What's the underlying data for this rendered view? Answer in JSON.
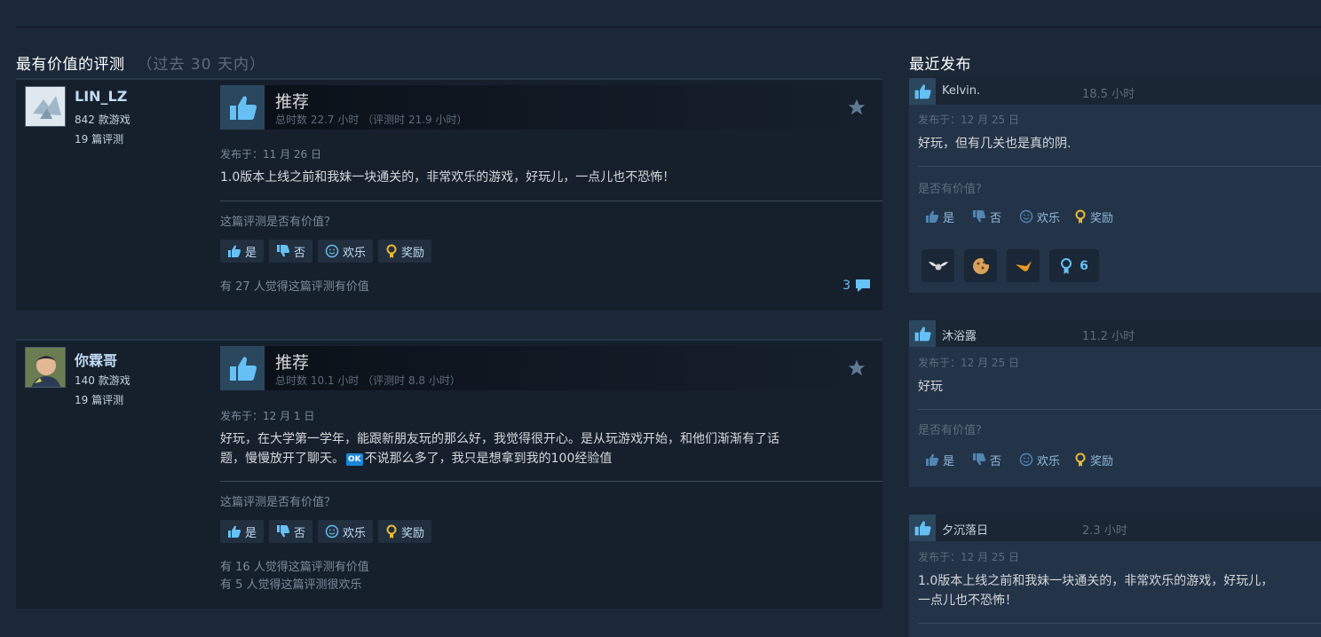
{
  "left_section": {
    "title": "最有价值的评测",
    "subtitle": "（过去 30 天内）"
  },
  "right_section": {
    "title": "最近发布"
  },
  "reviews": [
    {
      "author": "LIN_LZ",
      "games": "842 款游戏",
      "review_count": "19 篇评测",
      "verdict": "推荐",
      "hours": "总时数 22.7 小时 （评测时 21.9 小时）",
      "posted": "发布于：11 月 26 日",
      "text": "1.0版本上线之前和我妹一块通关的，非常欢乐的游戏，好玩儿，一点儿也不恐怖！",
      "helpful_question": "这篇评测是否有价值？",
      "buttons": {
        "yes": "是",
        "no": "否",
        "funny": "欢乐",
        "award": "奖励"
      },
      "helpful_line1": "有 27 人觉得这篇评测有价值",
      "helpful_line2": "",
      "comments": "3"
    },
    {
      "author": "你霖哥",
      "games": "140 款游戏",
      "review_count": "19 篇评测",
      "verdict": "推荐",
      "hours": "总时数 10.1 小时 （评测时 8.8 小时）",
      "posted": "发布于：12 月 1 日",
      "text_line1": "好玩，在大学第一学年，能跟新朋友玩的那么好，我觉得很开心。是从玩游戏开始，和他们渐渐有了话",
      "text_line2_a": "题，慢慢放开了聊天。",
      "text_ok": "OK",
      "text_line2_b": "不说那么多了，我只是想拿到我的100经验值",
      "helpful_question": "这篇评测是否有价值？",
      "buttons": {
        "yes": "是",
        "no": "否",
        "funny": "欢乐",
        "award": "奖励"
      },
      "helpful_line1": "有 16 人觉得这篇评测有价值",
      "helpful_line2": "有 5 人觉得这篇评测很欢乐"
    }
  ],
  "recent": [
    {
      "name": "Kelvin.",
      "hours": "18.5 小时",
      "posted": "发布于：12 月 25 日",
      "text": "好玩，但有几关也是真的阴.",
      "helpful_question": "是否有价值?",
      "buttons": {
        "yes": "是",
        "no": "否",
        "funny": "欢乐",
        "award": "奖励"
      },
      "award_count": "6"
    },
    {
      "name": "沐浴露",
      "hours": "11.2 小时",
      "posted": "发布于：12 月 25 日",
      "text": "好玩",
      "helpful_question": "是否有价值?",
      "buttons": {
        "yes": "是",
        "no": "否",
        "funny": "欢乐",
        "award": "奖励"
      }
    },
    {
      "name": "夕沉落日",
      "hours": "2.3 小时",
      "posted": "发布于：12 月 25 日",
      "text_line1": "1.0版本上线之前和我妹一块通关的，非常欢乐的游戏，好玩儿，",
      "text_line2": "一点儿也不恐怖！"
    }
  ],
  "colors": {
    "background": "#1b2838",
    "accent": "#67c1f5",
    "thumb_bg": "#2a475e",
    "award_gold": "#e8b932"
  }
}
